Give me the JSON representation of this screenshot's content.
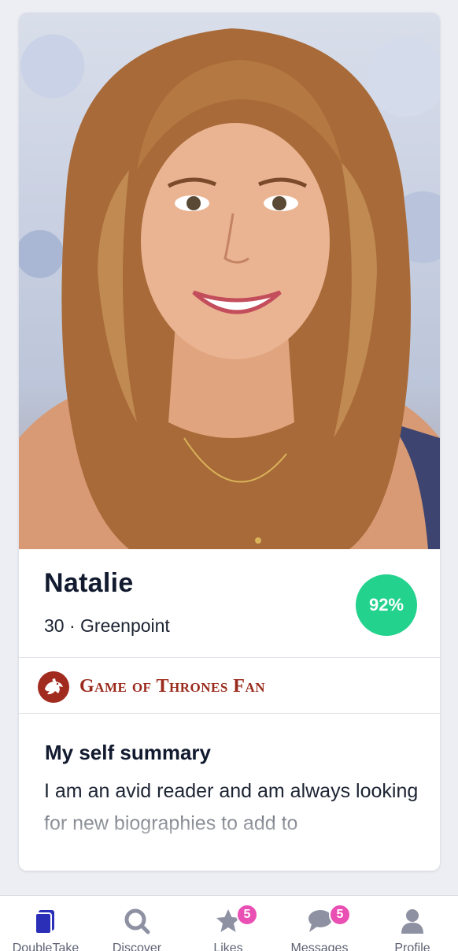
{
  "profile": {
    "name": "Natalie",
    "meta": "30 · Greenpoint",
    "match": "92%",
    "badge": "Game of Thrones Fan",
    "summary_title": "My self summary",
    "summary_body": "I am an avid reader and am always looking for new biographies to add to"
  },
  "nav": {
    "doubletake": "DoubleTake",
    "discover": "Discover",
    "likes": "Likes",
    "likes_count": "5",
    "messages": "Messages",
    "messages_count": "5",
    "profile": "Profile"
  },
  "colors": {
    "match_green": "#23d28d",
    "badge_red": "#9a2a1c",
    "notification_pink": "#ea4fb3",
    "active_tab": "#2b2fb8",
    "inactive_tab": "#8d91a2"
  },
  "icons": [
    "profile-photo",
    "dragon-icon",
    "doubletake-icon",
    "search-icon",
    "star-icon",
    "chat-bubble-icon",
    "person-icon"
  ]
}
